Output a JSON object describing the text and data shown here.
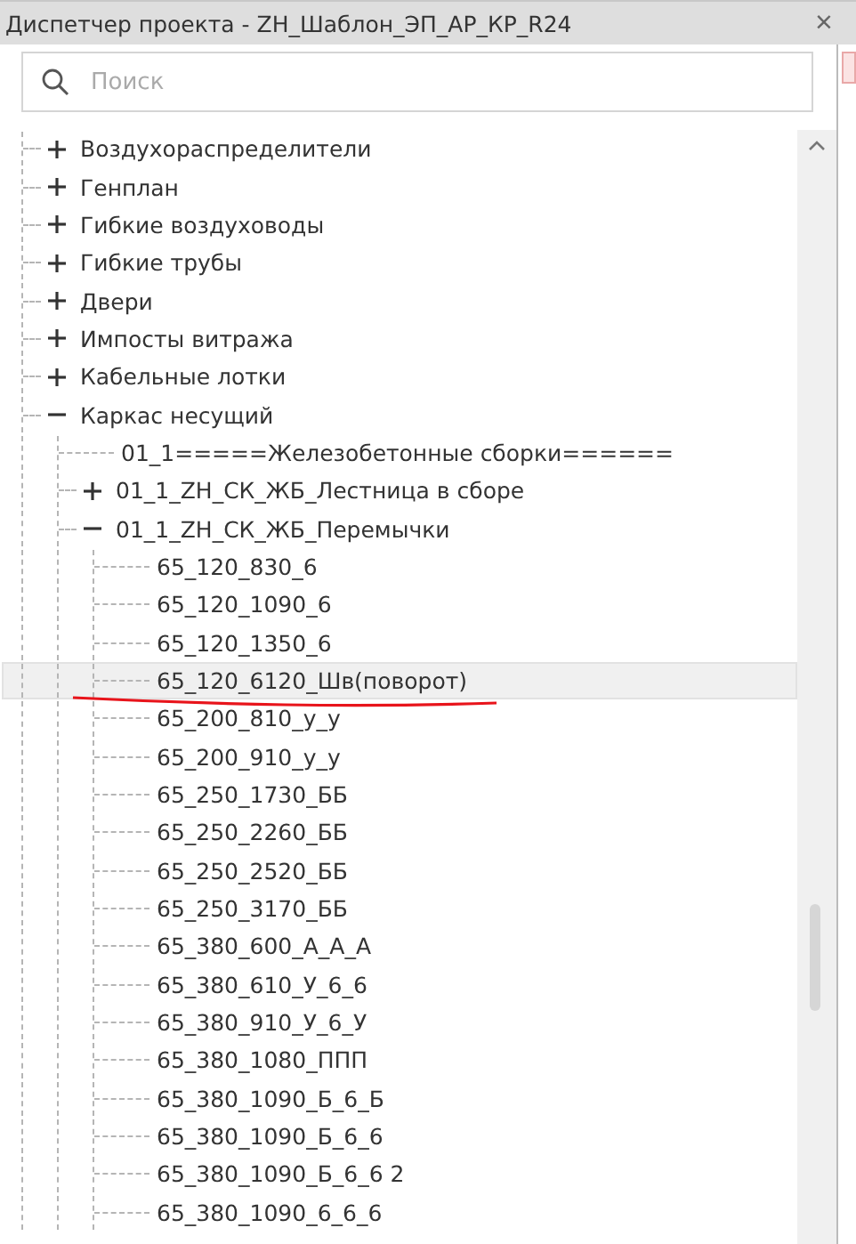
{
  "window": {
    "title": "Диспетчер проекта - ZH_Шаблон_ЭП_АР_КР_R24",
    "close": "×"
  },
  "search": {
    "placeholder": "Поиск"
  },
  "tree": [
    {
      "label": "Воздухораспределители",
      "expanded": false,
      "selected": false,
      "underlined": false
    },
    {
      "label": "Генплан",
      "expanded": false,
      "selected": false,
      "underlined": false
    },
    {
      "label": "Гибкие воздуховоды",
      "expanded": false,
      "selected": false,
      "underlined": false
    },
    {
      "label": "Гибкие трубы",
      "expanded": false,
      "selected": false,
      "underlined": false
    },
    {
      "label": "Двери",
      "expanded": false,
      "selected": false,
      "underlined": false
    },
    {
      "label": "Импосты витража",
      "expanded": false,
      "selected": false,
      "underlined": false
    },
    {
      "label": "Кабельные лотки",
      "expanded": false,
      "selected": false,
      "underlined": false
    },
    {
      "label": "Каркас несущий",
      "expanded": true,
      "selected": false,
      "underlined": false,
      "children": [
        {
          "label": "01_1=====Железобетонные сборки======",
          "selected": false,
          "underlined": false
        },
        {
          "label": "01_1_ZH_СК_ЖБ_Лестница в сборе",
          "expanded": false,
          "selected": false,
          "underlined": false
        },
        {
          "label": "01_1_ZH_СК_ЖБ_Перемычки",
          "expanded": true,
          "selected": false,
          "underlined": false,
          "children": [
            {
              "label": "65_120_830_6",
              "selected": false,
              "underlined": false
            },
            {
              "label": "65_120_1090_6",
              "selected": false,
              "underlined": false
            },
            {
              "label": "65_120_1350_6",
              "selected": false,
              "underlined": false
            },
            {
              "label": "65_120_6120_Шв(поворот)",
              "selected": true,
              "underlined": true
            },
            {
              "label": "65_200_810_у_у",
              "selected": false,
              "underlined": false
            },
            {
              "label": "65_200_910_у_у",
              "selected": false,
              "underlined": false
            },
            {
              "label": "65_250_1730_ББ",
              "selected": false,
              "underlined": false
            },
            {
              "label": "65_250_2260_ББ",
              "selected": false,
              "underlined": false
            },
            {
              "label": "65_250_2520_ББ",
              "selected": false,
              "underlined": false
            },
            {
              "label": "65_250_3170_ББ",
              "selected": false,
              "underlined": false
            },
            {
              "label": "65_380_600_А_А_А",
              "selected": false,
              "underlined": false
            },
            {
              "label": "65_380_610_У_6_6",
              "selected": false,
              "underlined": false
            },
            {
              "label": "65_380_910_У_6_У",
              "selected": false,
              "underlined": false
            },
            {
              "label": "65_380_1080_ППП",
              "selected": false,
              "underlined": false
            },
            {
              "label": "65_380_1090_Б_6_Б",
              "selected": false,
              "underlined": false
            },
            {
              "label": "65_380_1090_Б_6_6",
              "selected": false,
              "underlined": false
            },
            {
              "label": "65_380_1090_Б_6_6 2",
              "selected": false,
              "underlined": false
            },
            {
              "label": "65_380_1090_6_6_6",
              "selected": false,
              "underlined": false
            }
          ]
        }
      ]
    }
  ]
}
